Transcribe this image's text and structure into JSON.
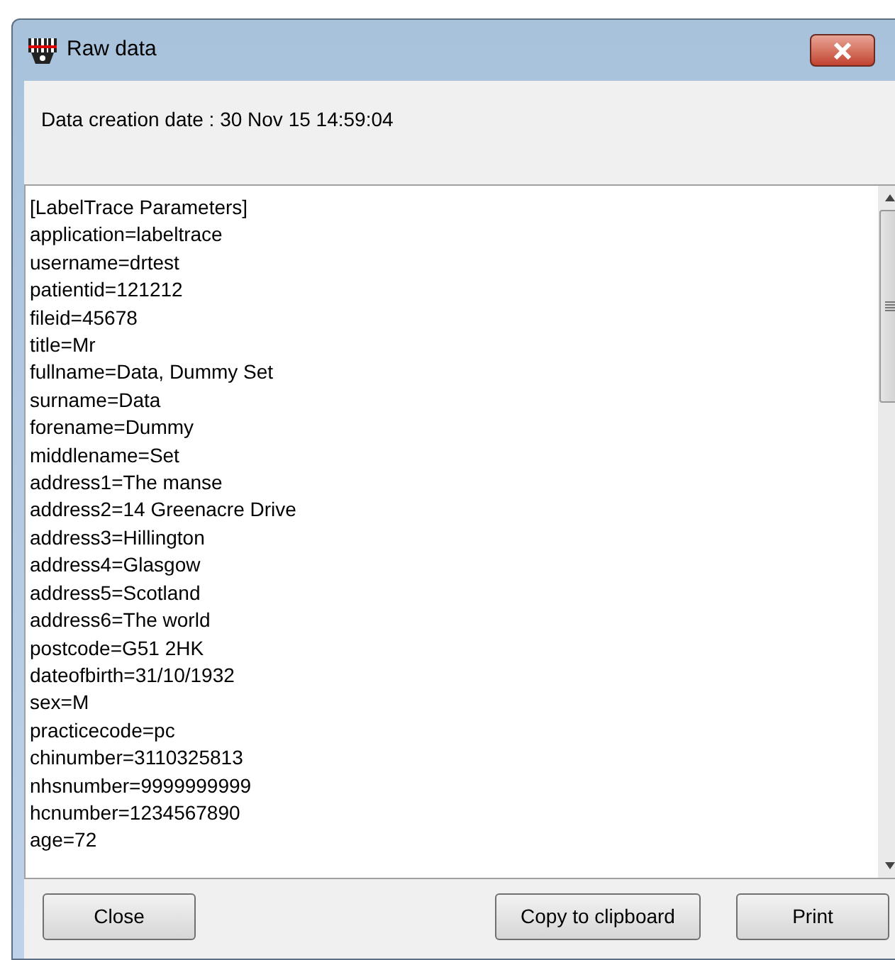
{
  "window": {
    "title": "Raw data"
  },
  "creation_date": "Data creation date : 30 Nov 15 14:59:04",
  "raw_lines": [
    "[LabelTrace Parameters]",
    "application=labeltrace",
    "username=drtest",
    "patientid=121212",
    "fileid=45678",
    "title=Mr",
    "fullname=Data, Dummy Set",
    "surname=Data",
    "forename=Dummy",
    "middlename=Set",
    "address1=The manse",
    "address2=14 Greenacre Drive",
    "address3=Hillington",
    "address4=Glasgow",
    "address5=Scotland",
    "address6=The world",
    "postcode=G51 2HK",
    "dateofbirth=31/10/1932",
    "sex=M",
    "practicecode=pc",
    "chinumber=3110325813",
    "nhsnumber=9999999999",
    "hcnumber=1234567890",
    "age=72"
  ],
  "buttons": [
    {
      "label": "Close"
    },
    {
      "label": "Copy to clipboard"
    },
    {
      "label": "Print"
    }
  ]
}
